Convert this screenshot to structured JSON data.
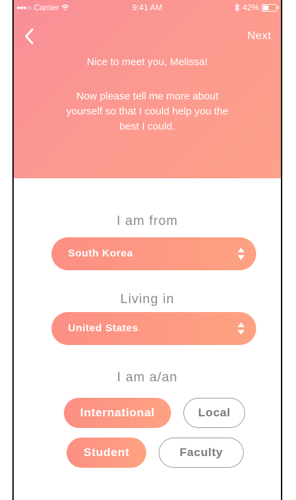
{
  "status_bar": {
    "carrier": "Carrier",
    "time": "9:41 AM",
    "battery": "42%",
    "battery_level": 0.42
  },
  "nav": {
    "next_label": "Next"
  },
  "header": {
    "greeting": "Nice to meet you, Melissa!",
    "intro": "Now please tell me more about yourself so that I could help you the best I could."
  },
  "form": {
    "from_label": "I am from",
    "from_value": "South Korea",
    "living_label": "Living in",
    "living_value": "United States",
    "role_label": "I am a/an",
    "chips": {
      "international": "International",
      "local": "Local",
      "student": "Student",
      "faculty": "Faculty"
    },
    "selected": [
      "International",
      "Student"
    ]
  },
  "colors": {
    "header_gradient_start": "#f88e98",
    "header_gradient_end": "#fda08a",
    "accent": "#fc9a84",
    "label_gray": "#8a8a8a"
  }
}
